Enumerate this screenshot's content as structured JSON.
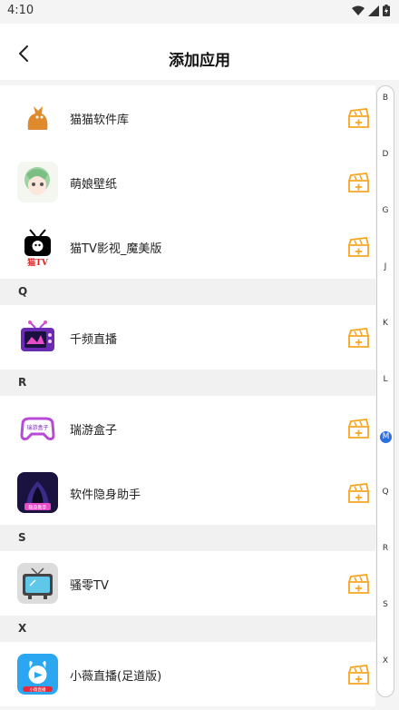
{
  "status": {
    "time": "4:10"
  },
  "header": {
    "title": "添加应用"
  },
  "list": [
    {
      "type": "item",
      "name": "猫猫软件库",
      "icon": "cat-logo-icon"
    },
    {
      "type": "item",
      "name": "萌娘壁纸",
      "icon": "anime-girl-icon"
    },
    {
      "type": "item",
      "name": "猫TV影视_魔美版",
      "icon": "tv-cat-icon"
    },
    {
      "type": "section",
      "letter": "Q"
    },
    {
      "type": "item",
      "name": "千频直播",
      "icon": "purple-tv-icon"
    },
    {
      "type": "section",
      "letter": "R"
    },
    {
      "type": "item",
      "name": "瑞游盒子",
      "icon": "gamepad-icon"
    },
    {
      "type": "item",
      "name": "软件隐身助手",
      "icon": "hooded-figure-icon"
    },
    {
      "type": "section",
      "letter": "S"
    },
    {
      "type": "item",
      "name": "骚零TV",
      "icon": "retro-tv-icon"
    },
    {
      "type": "section",
      "letter": "X"
    },
    {
      "type": "item",
      "name": "小薇直播(足道版)",
      "icon": "bunny-app-icon"
    }
  ],
  "index": {
    "letters": [
      "B",
      "D",
      "G",
      "J",
      "K",
      "L",
      "M",
      "Q",
      "R",
      "S",
      "X"
    ],
    "active": "M"
  },
  "accent_color": "#f5a623",
  "index_active_color": "#2b6fe0",
  "icons": {
    "tv_cat_text": "猫TV",
    "gamepad_text": "瑞游盒子",
    "hooded_text": "隐身助手",
    "bunny_text": "小薇直播"
  }
}
